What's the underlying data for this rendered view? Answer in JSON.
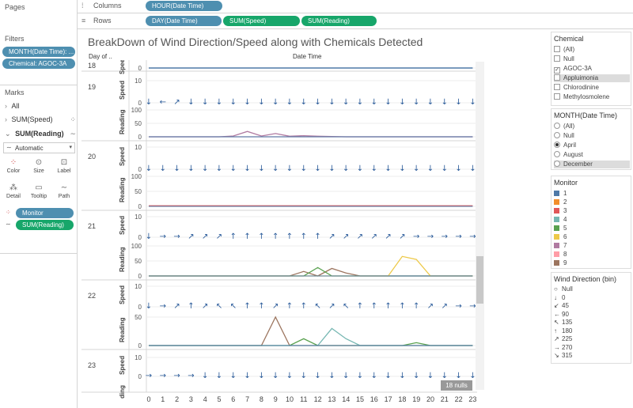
{
  "shelves": {
    "pages_label": "Pages",
    "columns_label": "Columns",
    "rows_label": "Rows",
    "columns_pills": [
      "HOUR(Date Time)"
    ],
    "rows_pills": [
      "DAY(Date Time)",
      "SUM(Speed)",
      "SUM(Reading)"
    ]
  },
  "filters": {
    "title": "Filters",
    "pills": [
      "MONTH(Date Time): ...",
      "Chemical: AGOC-3A"
    ]
  },
  "marks": {
    "title": "Marks",
    "all_label": "All",
    "layers": [
      "SUM(Speed)",
      "SUM(Reading)"
    ],
    "mark_type": "Automatic",
    "buttons": [
      "Color",
      "Size",
      "Label",
      "Detail",
      "Tooltip",
      "Path"
    ],
    "field_pills": [
      "Monitor",
      "SUM(Reading)"
    ]
  },
  "viz": {
    "title": "BreakDown of Wind Direction/Speed along with Chemicals Detected",
    "row_header": "Day of ..",
    "col_header": "Date Time",
    "nulls_badge": "18 nulls"
  },
  "chemical_filter": {
    "title": "Chemical",
    "options": [
      {
        "label": "(All)",
        "checked": false
      },
      {
        "label": "Null",
        "checked": false
      },
      {
        "label": "AGOC-3A",
        "checked": true
      },
      {
        "label": "Appluimonia",
        "checked": false,
        "highlight": true
      },
      {
        "label": "Chlorodinine",
        "checked": false
      },
      {
        "label": "Methylosmolene",
        "checked": false
      }
    ]
  },
  "month_filter": {
    "title": "MONTH(Date Time)",
    "options": [
      {
        "label": "(All)",
        "selected": false
      },
      {
        "label": "Null",
        "selected": false
      },
      {
        "label": "April",
        "selected": true
      },
      {
        "label": "August",
        "selected": false
      },
      {
        "label": "December",
        "selected": false,
        "highlight": true
      }
    ]
  },
  "monitor_legend": {
    "title": "Monitor",
    "items": [
      {
        "label": "1",
        "color": "#4e79a7"
      },
      {
        "label": "2",
        "color": "#f28e2b"
      },
      {
        "label": "3",
        "color": "#e15759"
      },
      {
        "label": "4",
        "color": "#76b7b2"
      },
      {
        "label": "5",
        "color": "#59a14f"
      },
      {
        "label": "6",
        "color": "#edc948"
      },
      {
        "label": "7",
        "color": "#b07aa1"
      },
      {
        "label": "8",
        "color": "#ff9da7"
      },
      {
        "label": "9",
        "color": "#9c755f"
      }
    ]
  },
  "wind_legend": {
    "title": "Wind Direction (bin)",
    "items": [
      {
        "label": "Null",
        "icon": "circle-icon"
      },
      {
        "label": "0",
        "icon": "arrow-down-icon"
      },
      {
        "label": "45",
        "icon": "arrow-down-left-icon"
      },
      {
        "label": "90",
        "icon": "arrow-left-icon"
      },
      {
        "label": "135",
        "icon": "arrow-up-left-icon"
      },
      {
        "label": "180",
        "icon": "arrow-up-icon"
      },
      {
        "label": "225",
        "icon": "arrow-up-right-icon"
      },
      {
        "label": "270",
        "icon": "arrow-right-icon"
      },
      {
        "label": "315",
        "icon": "arrow-down-right-icon"
      }
    ]
  },
  "chart_data": {
    "type": "line",
    "title": "BreakDown of Wind Direction/Speed along with Chemicals Detected",
    "xlabel": "Date Time",
    "x": [
      0,
      1,
      2,
      3,
      4,
      5,
      6,
      7,
      8,
      9,
      10,
      11,
      12,
      13,
      14,
      15,
      16,
      17,
      18,
      19,
      20,
      21,
      22,
      23
    ],
    "days": [
      {
        "day": "18",
        "speed_ticks": [
          "0"
        ],
        "reading_ticks": [],
        "speed_arrows": [],
        "readings": [],
        "speed_baseline": true
      },
      {
        "day": "19",
        "speed_ticks": [
          "10",
          "0"
        ],
        "reading_ticks": [
          "100",
          "50",
          "0"
        ],
        "speed_arrows": [
          "0",
          "90",
          "225",
          "0",
          "0",
          "0",
          "0",
          "0",
          "0",
          "0",
          "0",
          "0",
          "0",
          "0",
          "0",
          "0",
          "0",
          "0",
          "0",
          "0",
          "0",
          "0",
          "0",
          "0"
        ],
        "readings": [
          {
            "monitor": "7",
            "values": [
              0,
              0,
              0,
              0,
              0,
              0,
              0,
              0,
              0,
              0,
              0,
              0,
              0,
              0,
              0,
              0,
              0,
              0,
              0,
              0,
              0,
              0,
              0,
              0
            ]
          },
          {
            "monitor": "7",
            "values": [
              0,
              0,
              0,
              0,
              0,
              0,
              3,
              20,
              3,
              12,
              2,
              4,
              2,
              1,
              0,
              0,
              0,
              0,
              0,
              0,
              0,
              0,
              0,
              0
            ]
          }
        ]
      },
      {
        "day": "20",
        "speed_ticks": [
          "10",
          "0"
        ],
        "reading_ticks": [
          "100",
          "50",
          "0"
        ],
        "speed_arrows": [
          "0",
          "0",
          "0",
          "0",
          "0",
          "0",
          "0",
          "0",
          "0",
          "0",
          "0",
          "0",
          "0",
          "0",
          "0",
          "0",
          "0",
          "0",
          "0",
          "0",
          "0",
          "0",
          "0",
          "0"
        ],
        "readings": [
          {
            "monitor": "3",
            "values": [
              2,
              2,
              2,
              2,
              2,
              2,
              2,
              2,
              2,
              2,
              2,
              2,
              2,
              2,
              2,
              2,
              2,
              2,
              2,
              2,
              2,
              2,
              2,
              2
            ]
          }
        ]
      },
      {
        "day": "21",
        "speed_ticks": [
          "10",
          "0"
        ],
        "reading_ticks": [
          "100",
          "50",
          "0"
        ],
        "speed_arrows": [
          "0",
          "270",
          "270",
          "225",
          "225",
          "225",
          "180",
          "180",
          "180",
          "180",
          "180",
          "180",
          "180",
          "225",
          "225",
          "225",
          "225",
          "225",
          "225",
          "270",
          "270",
          "270",
          "270",
          "270"
        ],
        "readings": [
          {
            "monitor": "9",
            "values": [
              0,
              0,
              0,
              0,
              0,
              0,
              0,
              0,
              0,
              0,
              0,
              15,
              0,
              25,
              10,
              0,
              0,
              0,
              0,
              0,
              0,
              0,
              0,
              0
            ]
          },
          {
            "monitor": "5",
            "values": [
              0,
              0,
              0,
              0,
              0,
              0,
              0,
              0,
              0,
              0,
              0,
              0,
              28,
              0,
              0,
              0,
              0,
              0,
              0,
              0,
              0,
              0,
              0,
              0
            ]
          },
          {
            "monitor": "6",
            "values": [
              0,
              0,
              0,
              0,
              0,
              0,
              0,
              0,
              0,
              0,
              0,
              0,
              0,
              0,
              0,
              0,
              0,
              0,
              65,
              55,
              0,
              0,
              0,
              0
            ]
          }
        ]
      },
      {
        "day": "22",
        "speed_ticks": [
          "10",
          "0"
        ],
        "reading_ticks": [
          "50",
          "0"
        ],
        "speed_arrows": [
          "0",
          "270",
          "225",
          "180",
          "225",
          "135",
          "135",
          "180",
          "180",
          "225",
          "180",
          "180",
          "135",
          "225",
          "135",
          "180",
          "180",
          "180",
          "180",
          "180",
          "225",
          "225",
          "270",
          "270"
        ],
        "readings": [
          {
            "monitor": "9",
            "values": [
              0,
              0,
              0,
              0,
              0,
              0,
              0,
              0,
              0,
              50,
              0,
              0,
              0,
              0,
              0,
              0,
              0,
              0,
              0,
              0,
              0,
              0,
              0,
              0
            ]
          },
          {
            "monitor": "5",
            "values": [
              0,
              0,
              0,
              0,
              0,
              0,
              0,
              0,
              0,
              0,
              0,
              12,
              0,
              0,
              0,
              0,
              0,
              0,
              0,
              5,
              0,
              0,
              0,
              0
            ]
          },
          {
            "monitor": "4",
            "values": [
              0,
              0,
              0,
              0,
              0,
              0,
              0,
              0,
              0,
              0,
              0,
              0,
              0,
              30,
              12,
              0,
              0,
              0,
              0,
              0,
              0,
              0,
              0,
              0
            ]
          }
        ]
      },
      {
        "day": "23",
        "speed_ticks": [
          "10",
          "0"
        ],
        "reading_ticks": [],
        "speed_arrows": [
          "270",
          "270",
          "270",
          "270",
          "0",
          "0",
          "0",
          "0",
          "0",
          "0",
          "0",
          "0",
          "0",
          "0",
          "0",
          "0",
          "0",
          "0",
          "0",
          "0",
          "0",
          "0",
          "0",
          "0"
        ],
        "readings": []
      }
    ]
  }
}
